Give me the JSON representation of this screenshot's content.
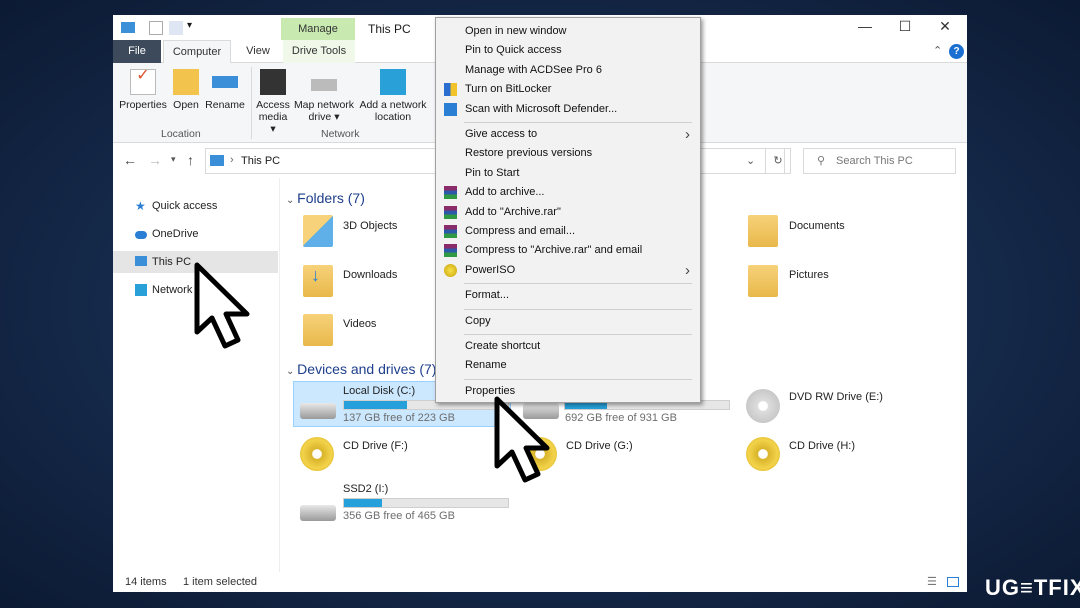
{
  "window": {
    "title": "This PC",
    "manage_tab": "Manage",
    "tabs": [
      "File",
      "Computer",
      "View",
      "Drive Tools"
    ],
    "controls": {
      "minimize": "—",
      "maximize": "☐",
      "close": "✕"
    }
  },
  "ribbon": {
    "buttons": [
      {
        "label": "Properties"
      },
      {
        "label": "Open"
      },
      {
        "label": "Rename"
      },
      {
        "label": "Access media ▾"
      },
      {
        "label": "Map network drive ▾"
      },
      {
        "label": "Add a network location"
      }
    ],
    "groups": [
      "Location",
      "Network"
    ]
  },
  "address": {
    "path": "This PC",
    "search_placeholder": "Search This PC"
  },
  "sidebar": {
    "items": [
      {
        "label": "Quick access",
        "icon": "star-icon"
      },
      {
        "label": "OneDrive",
        "icon": "cloud-icon"
      },
      {
        "label": "This PC",
        "icon": "computer-icon"
      },
      {
        "label": "Network",
        "icon": "network-icon"
      }
    ]
  },
  "folders": {
    "header": "Folders (7)",
    "items": [
      "3D Objects",
      "Documents",
      "Downloads",
      "Pictures",
      "Videos"
    ]
  },
  "drives": {
    "header": "Devices and drives (7)",
    "items": [
      {
        "name": "Local Disk (C:)",
        "free": "137 GB free of 223 GB",
        "used_fraction": 0.386
      },
      {
        "name": "",
        "free": "692 GB free of 931 GB",
        "used_fraction": 0.257
      },
      {
        "name": "DVD RW Drive (E:)"
      },
      {
        "name": "CD Drive (F:)"
      },
      {
        "name": "CD Drive (G:)"
      },
      {
        "name": "CD Drive (H:)"
      },
      {
        "name": "SSD2 (I:)",
        "free": "356 GB free of 465 GB",
        "used_fraction": 0.234
      }
    ]
  },
  "status": {
    "items": "14 items",
    "selected": "1 item selected"
  },
  "context_menu": {
    "items": [
      "Open in new window",
      "Pin to Quick access",
      "Manage with ACDSee Pro 6",
      "Turn on BitLocker",
      "Scan with Microsoft Defender...",
      "Give access to",
      "Restore previous versions",
      "Pin to Start",
      "Add to archive...",
      "Add to \"Archive.rar\"",
      "Compress and email...",
      "Compress to \"Archive.rar\" and email",
      "PowerISO",
      "Format...",
      "Copy",
      "Create shortcut",
      "Rename",
      "Properties"
    ]
  },
  "watermark": "UG≡TFIX"
}
